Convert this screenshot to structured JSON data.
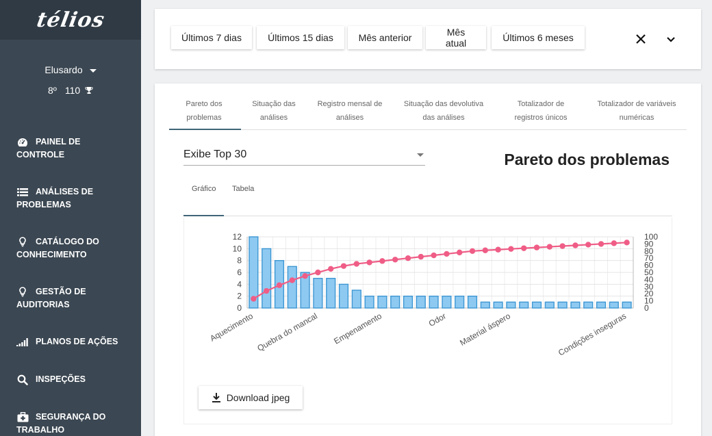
{
  "brand": {
    "logo_text": "télios"
  },
  "user": {
    "name": "Elusardo",
    "rank": "8º",
    "points": "110"
  },
  "sidebar": {
    "items": [
      {
        "label": "PAINEL DE CONTROLE",
        "icon": "dashboard-icon"
      },
      {
        "label": "ANÁLISES DE PROBLEMAS",
        "icon": "list-icon"
      },
      {
        "label": "CATÁLOGO DO CONHECIMENTO",
        "icon": "lightbulb-icon"
      },
      {
        "label": "GESTÃO DE AUDITORIAS",
        "icon": "lightbulb-icon"
      },
      {
        "label": "PLANOS DE AÇÕES",
        "icon": "signal-bars-icon"
      },
      {
        "label": "INSPEÇÕES",
        "icon": "search-icon"
      },
      {
        "label": "SEGURANÇA DO TRABALHO",
        "icon": "medkit-icon"
      }
    ]
  },
  "filters": {
    "buttons": [
      "Últimos 7 dias",
      "Últimos 15 dias",
      "Mês anterior",
      "Mês atual",
      "Últimos 6 meses"
    ]
  },
  "tabs": [
    {
      "line1": "Pareto dos",
      "line2": "problemas"
    },
    {
      "line1": "Situação das",
      "line2": "análises"
    },
    {
      "line1": "Registro mensal de",
      "line2": "análises"
    },
    {
      "line1": "Situação das devolutiva",
      "line2": "das análises"
    },
    {
      "line1": "Totalizador de",
      "line2": "registros únicos"
    },
    {
      "line1": "Totalizador de variáveis",
      "line2": "numéricas"
    }
  ],
  "selector": {
    "value": "Exibe Top 30"
  },
  "panel_title": "Pareto dos problemas",
  "subtabs": [
    "Gráfico",
    "Tabela"
  ],
  "download_label": "Download jpeg",
  "colors": {
    "bar_fill": "#8ec9f1",
    "bar_stroke": "#3d97d3",
    "line": "#ef5d86",
    "sidebar": "#3b4752"
  },
  "chart_data": {
    "type": "bar",
    "title": "",
    "xlabel": "",
    "ylabel": "",
    "ylim": [
      0,
      12
    ],
    "y2lim": [
      0,
      100
    ],
    "y_ticks": [
      0,
      2,
      4,
      6,
      8,
      10,
      12
    ],
    "y2_ticks": [
      0,
      10,
      20,
      30,
      40,
      50,
      60,
      70,
      80,
      90,
      100
    ],
    "x_tick_labels": [
      {
        "index": 0,
        "label": "Aquecimento"
      },
      {
        "index": 5,
        "label": "Quebra do mancal"
      },
      {
        "index": 10,
        "label": "Empenamento"
      },
      {
        "index": 15,
        "label": "Odor"
      },
      {
        "index": 20,
        "label": "Material áspero"
      },
      {
        "index": 29,
        "label": "Condições inseguras"
      }
    ],
    "grid": true,
    "series": [
      {
        "type": "bar",
        "axis": "left",
        "values": [
          12,
          10,
          8,
          7,
          6,
          5,
          5,
          4,
          3,
          2,
          2,
          2,
          2,
          2,
          2,
          2,
          2,
          2,
          1,
          1,
          1,
          1,
          1,
          1,
          1,
          1,
          1,
          1,
          1,
          1
        ]
      },
      {
        "type": "line",
        "axis": "right",
        "values": [
          13,
          24,
          32,
          39,
          45,
          50,
          55,
          59,
          62,
          64,
          66,
          68,
          70,
          72,
          74,
          76,
          78,
          80,
          81,
          82,
          83,
          84,
          85,
          86,
          87,
          88,
          89,
          90,
          91,
          92
        ]
      }
    ]
  }
}
